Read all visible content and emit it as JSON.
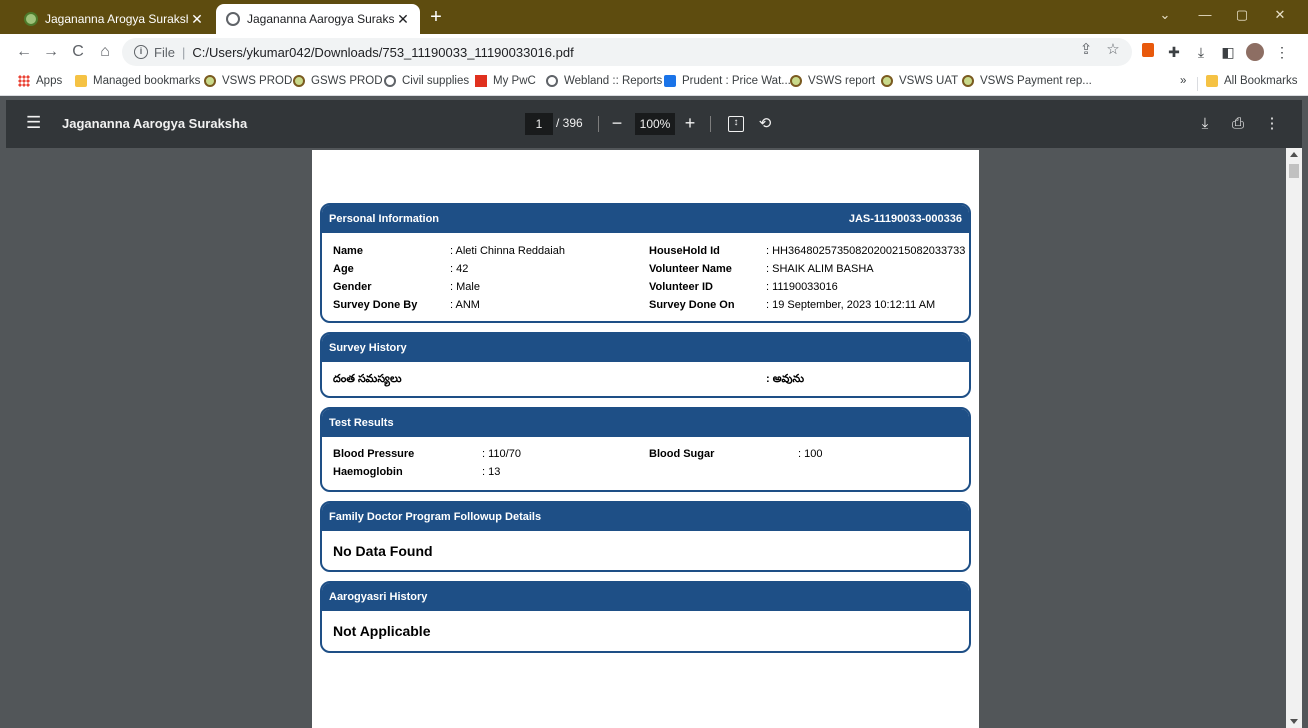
{
  "browser": {
    "tabs": [
      {
        "title": "Jagananna Arogya Suraksha",
        "active": false
      },
      {
        "title": "Jagananna Aarogya Suraksha",
        "active": true
      }
    ],
    "close_glyph": "✕",
    "new_tab_glyph": "+",
    "window_controls": {
      "minimize": "—",
      "maximize": "▢",
      "close": "✕"
    },
    "address": {
      "scheme": "File",
      "separator": "|",
      "url": "C:/Users/ykumar042/Downloads/753_11190033_11190033016.pdf"
    },
    "nav": {
      "back": "←",
      "forward": "→",
      "reload": "C",
      "home": "⌂"
    },
    "bookmarks": [
      {
        "label": "Apps",
        "icon": "apps-grid-icon"
      },
      {
        "label": "Managed bookmarks",
        "icon": "folder-icon"
      },
      {
        "label": "VSWS PROD",
        "icon": "vsws-icon"
      },
      {
        "label": "GSWS PROD",
        "icon": "vsws-icon"
      },
      {
        "label": "Civil supplies",
        "icon": "globe-icon"
      },
      {
        "label": "My PwC",
        "icon": "pwc-icon"
      },
      {
        "label": "Webland :: Reports",
        "icon": "globe-icon"
      },
      {
        "label": "Prudent : Price Wat...",
        "icon": "prudent-icon"
      },
      {
        "label": "VSWS report",
        "icon": "vsws-icon"
      },
      {
        "label": "VSWS UAT",
        "icon": "vsws-icon"
      },
      {
        "label": "VSWS Payment rep...",
        "icon": "vsws-icon"
      }
    ],
    "bookmarks_overflow": "»",
    "all_bookmarks": "All Bookmarks"
  },
  "pdf_viewer": {
    "title": "Jagananna Aarogya Suraksha",
    "current_page": "1",
    "total_pages": "/ 396",
    "zoom": "100%",
    "zoom_out": "−",
    "zoom_in": "+"
  },
  "document": {
    "personal_info": {
      "heading": "Personal Information",
      "id": "JAS-11190033-000336",
      "fields_left": [
        {
          "label": "Name",
          "value": ": Aleti Chinna Reddaiah"
        },
        {
          "label": "Age",
          "value": ": 42"
        },
        {
          "label": "Gender",
          "value": ": Male"
        },
        {
          "label": "Survey Done By",
          "value": ": ANM"
        }
      ],
      "fields_right": [
        {
          "label": "HouseHold Id",
          "value": ": HH36480257350820200215082033733"
        },
        {
          "label": "Volunteer Name",
          "value": ": SHAIK ALIM BASHA"
        },
        {
          "label": "Volunteer ID",
          "value": ": 11190033016"
        },
        {
          "label": "Survey Done On",
          "value": ": 19 September, 2023 10:12:11 AM"
        }
      ]
    },
    "survey_history": {
      "heading": "Survey History",
      "question": "దంత సమస్యలు",
      "answer": ": అవును"
    },
    "test_results": {
      "heading": "Test Results",
      "blood_pressure_label": "Blood Pressure",
      "blood_pressure_value": ": 110/70",
      "blood_sugar_label": "Blood Sugar",
      "blood_sugar_value": ": 100",
      "haemoglobin_label": "Haemoglobin",
      "haemoglobin_value": ": 13"
    },
    "family_doctor": {
      "heading": "Family Doctor Program Followup Details",
      "message": "No Data Found"
    },
    "aarogyasri": {
      "heading": "Aarogyasri History",
      "message": "Not Applicable"
    }
  }
}
